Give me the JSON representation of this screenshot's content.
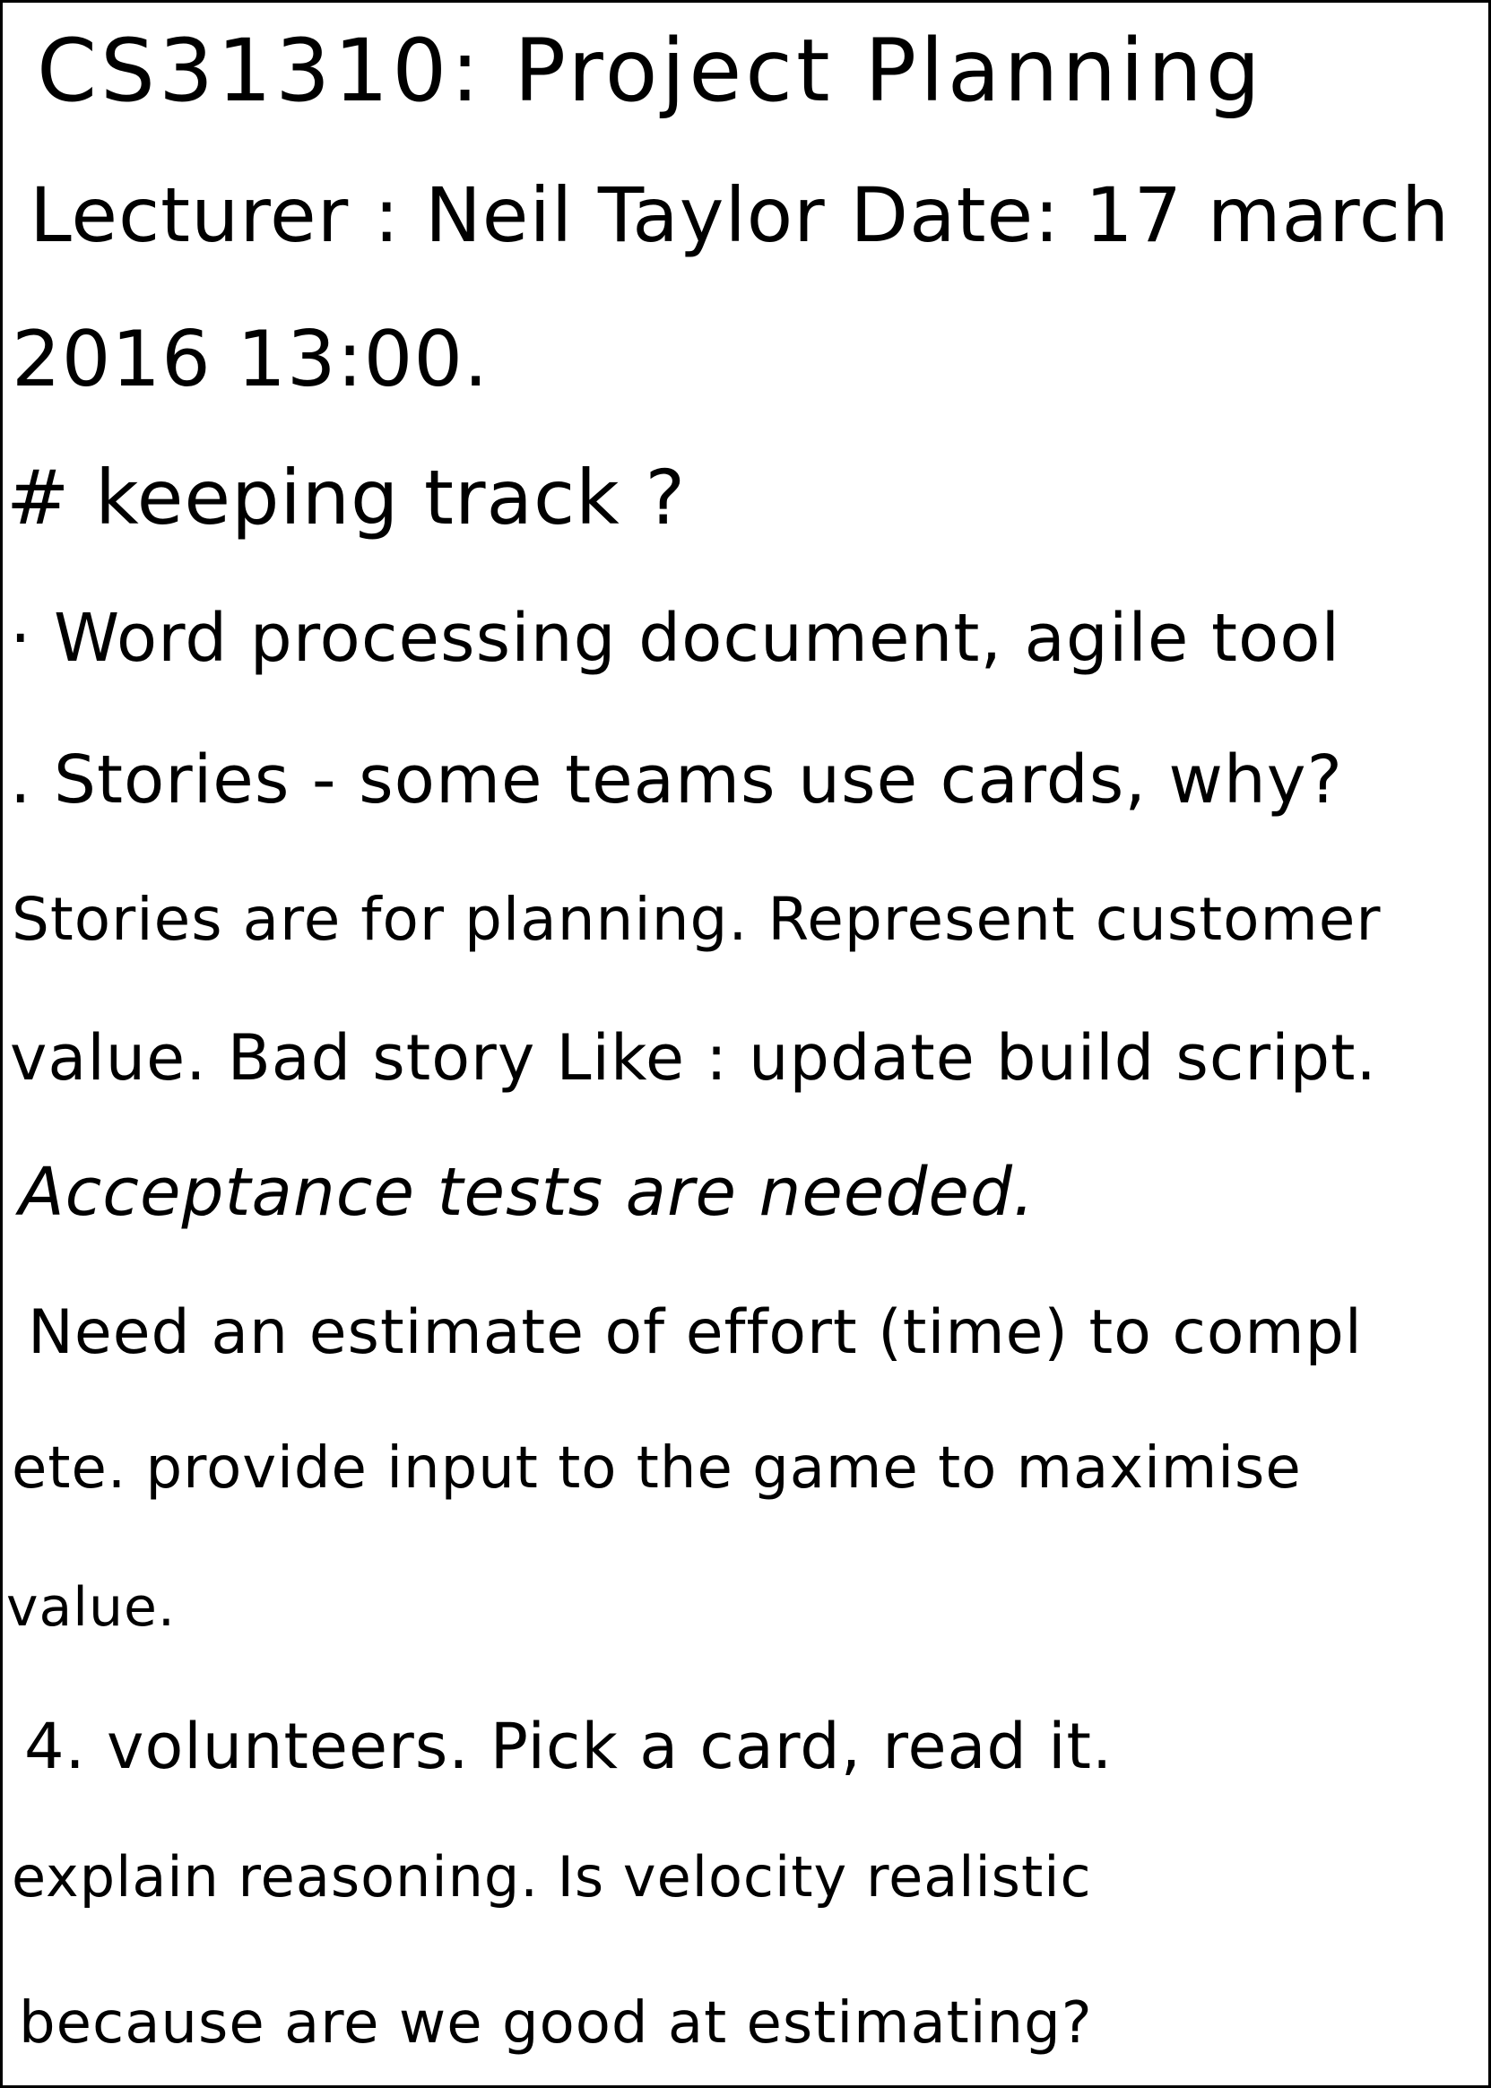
{
  "note": {
    "title": "CS31310: Project Planning",
    "lecturer_line": "Lecturer : Neil Taylor   Date: 17 march",
    "date_line": "2016 13:00.",
    "heading": "# keeping track ?",
    "bullet_1": "· Word processing document, agile tool",
    "bullet_2": ". Stories - some teams use cards, why?",
    "para_1": "Stories are for planning. Represent customer",
    "para_2": "value. Bad story Like : update build script.",
    "para_3": "Acceptance tests are needed.",
    "para_4": "Need an estimate of effort (time) to compl",
    "para_5": "ete. provide input to the game to maximise",
    "para_6": "value.",
    "para_7": "4. volunteers. Pick a card, read it.",
    "para_8": "explain reasoning. Is velocity realistic",
    "para_9": "because are we good at estimating?"
  }
}
